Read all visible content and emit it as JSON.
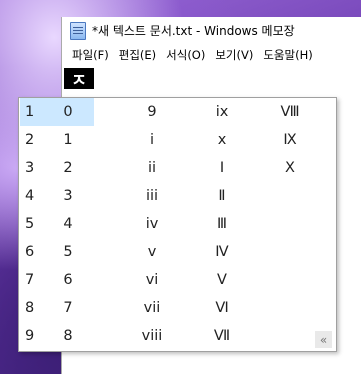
{
  "window": {
    "title": "*새 텍스트 문서.txt - Windows 메모장",
    "icon": "notepad-icon"
  },
  "menu": [
    "파일(F)",
    "편집(E)",
    "서식(O)",
    "보기(V)",
    "도움말(H)"
  ],
  "editor": {
    "composition_char": "ㅈ"
  },
  "candidate_window": {
    "selected_index": 0,
    "rows": [
      {
        "num": "1",
        "cells": [
          "0",
          "9",
          "ix",
          "Ⅷ"
        ]
      },
      {
        "num": "2",
        "cells": [
          "1",
          "i",
          "x",
          "Ⅸ"
        ]
      },
      {
        "num": "3",
        "cells": [
          "2",
          "ii",
          "Ⅰ",
          "Ⅹ"
        ]
      },
      {
        "num": "4",
        "cells": [
          "3",
          "iii",
          "Ⅱ",
          ""
        ]
      },
      {
        "num": "5",
        "cells": [
          "4",
          "iv",
          "Ⅲ",
          ""
        ]
      },
      {
        "num": "6",
        "cells": [
          "5",
          "v",
          "Ⅳ",
          ""
        ]
      },
      {
        "num": "7",
        "cells": [
          "6",
          "vi",
          "Ⅴ",
          ""
        ]
      },
      {
        "num": "8",
        "cells": [
          "7",
          "vii",
          "Ⅵ",
          ""
        ]
      },
      {
        "num": "9",
        "cells": [
          "8",
          "viii",
          "Ⅶ",
          ""
        ]
      }
    ],
    "expand_label": "«"
  }
}
